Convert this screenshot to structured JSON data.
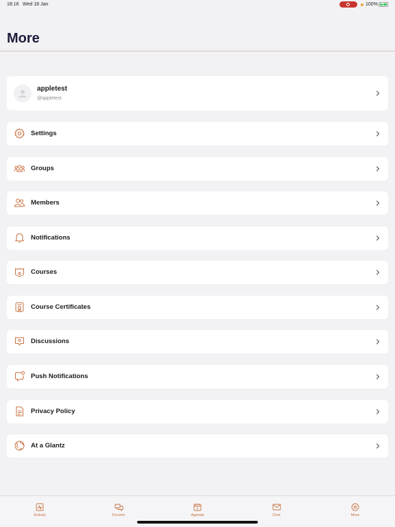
{
  "status_bar": {
    "time": "18:16",
    "date": "Wed 18 Jan",
    "battery": "100%"
  },
  "header": {
    "title": "More"
  },
  "profile": {
    "name": "appletest",
    "handle": "@appletest"
  },
  "menu": [
    {
      "label": "Settings",
      "icon": "gear-icon"
    },
    {
      "label": "Groups",
      "icon": "groups-icon"
    },
    {
      "label": "Members",
      "icon": "members-icon"
    },
    {
      "label": "Notifications",
      "icon": "bell-icon"
    },
    {
      "label": "Courses",
      "icon": "course-icon"
    },
    {
      "label": "Course Certificates",
      "icon": "certificate-icon"
    },
    {
      "label": "Discussions",
      "icon": "discussion-icon"
    },
    {
      "label": "Push Notifications",
      "icon": "push-notification-icon"
    },
    {
      "label": "Privacy Policy",
      "icon": "document-icon"
    },
    {
      "label": "At a Glantz",
      "icon": "globe-icon"
    }
  ],
  "tab_bar": [
    {
      "label": "Activity",
      "icon": "activity-icon"
    },
    {
      "label": "Forums",
      "icon": "forums-icon"
    },
    {
      "label": "Agenda",
      "icon": "calendar-icon"
    },
    {
      "label": "Chat",
      "icon": "mail-icon"
    },
    {
      "label": "More",
      "icon": "more-icon"
    }
  ],
  "colors": {
    "accent": "#c8703f",
    "background": "#f2f2f4",
    "card": "#ffffff",
    "title": "#1e1e3c",
    "recording": "#c8352e"
  }
}
